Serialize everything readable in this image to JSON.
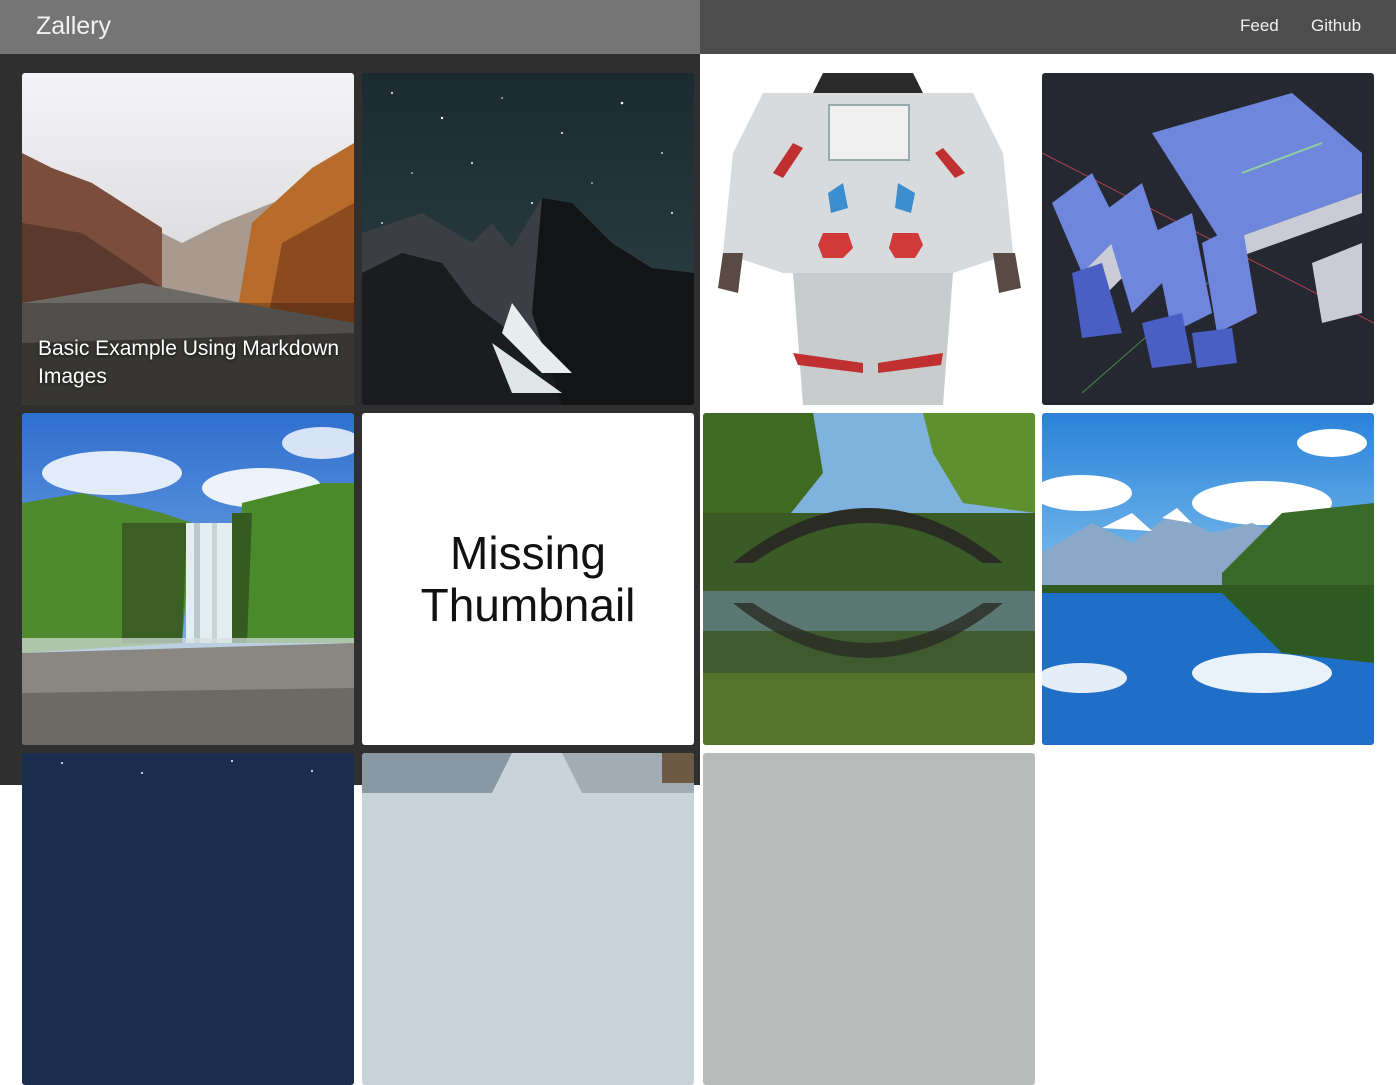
{
  "app": {
    "brand": "Zallery"
  },
  "nav": {
    "links": [
      "Feed",
      "Github"
    ]
  },
  "gallery": {
    "tiles": [
      {
        "name": "canyon",
        "caption": "Basic Example Using Markdown Images"
      },
      {
        "name": "night-mountain"
      },
      {
        "name": "astronaut"
      },
      {
        "name": "robot-hand"
      },
      {
        "name": "waterfall"
      },
      {
        "name": "missing",
        "text": "Missing Thumbnail"
      },
      {
        "name": "stone-bridge"
      },
      {
        "name": "lake"
      },
      {
        "name": "starry"
      },
      {
        "name": "snowy-cliff"
      },
      {
        "name": "fog"
      }
    ]
  },
  "colors": {
    "left_nav": "#757575",
    "right_nav": "#4d4d4d",
    "left_panel": "#2f2f2f",
    "right_panel": "#ffffff"
  }
}
